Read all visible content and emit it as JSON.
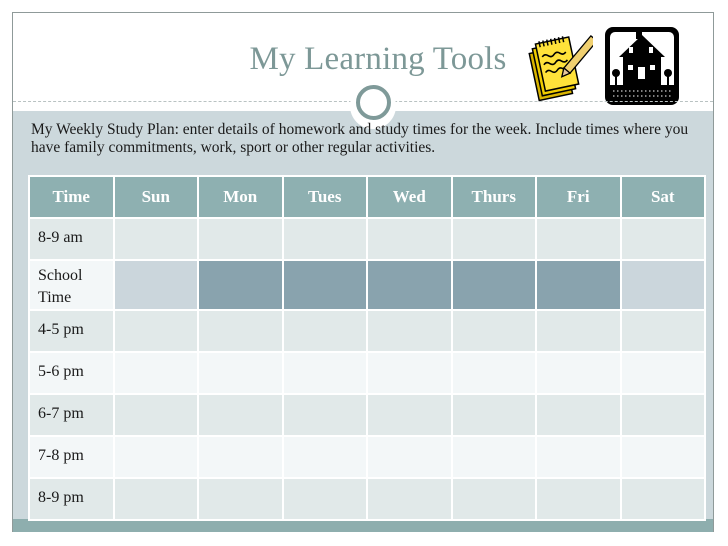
{
  "slide": {
    "title": "My Learning Tools",
    "intro": "My Weekly Study Plan: enter details of homework and study times for the week. Include times where you have family commitments, work, sport or other regular activities.",
    "icons": [
      "notepad-pencil-icon",
      "house-icon"
    ]
  },
  "colors": {
    "title": "#7d9897",
    "header": "#8eb0b1",
    "band": "#ccd8dc",
    "school_weekday": "#89a3ae",
    "school_weekend": "#cbd6dc",
    "row_alt_a": "#e1e9e9",
    "row_alt_b": "#f3f7f8"
  },
  "table": {
    "headers": [
      "Time",
      "Sun",
      "Mon",
      "Tues",
      "Wed",
      "Thurs",
      "Fri",
      "Sat"
    ],
    "rows": [
      {
        "time": "8-9 am"
      },
      {
        "time_line1": "School",
        "time_line2": "Time",
        "shaded": {
          "Sun": "light",
          "Mon": "dark",
          "Tues": "dark",
          "Wed": "dark",
          "Thurs": "dark",
          "Fri": "dark",
          "Sat": "light"
        }
      },
      {
        "time": "4-5 pm"
      },
      {
        "time": "5-6 pm"
      },
      {
        "time": "6-7 pm"
      },
      {
        "time": "7-8 pm"
      },
      {
        "time": "8-9 pm"
      }
    ]
  }
}
